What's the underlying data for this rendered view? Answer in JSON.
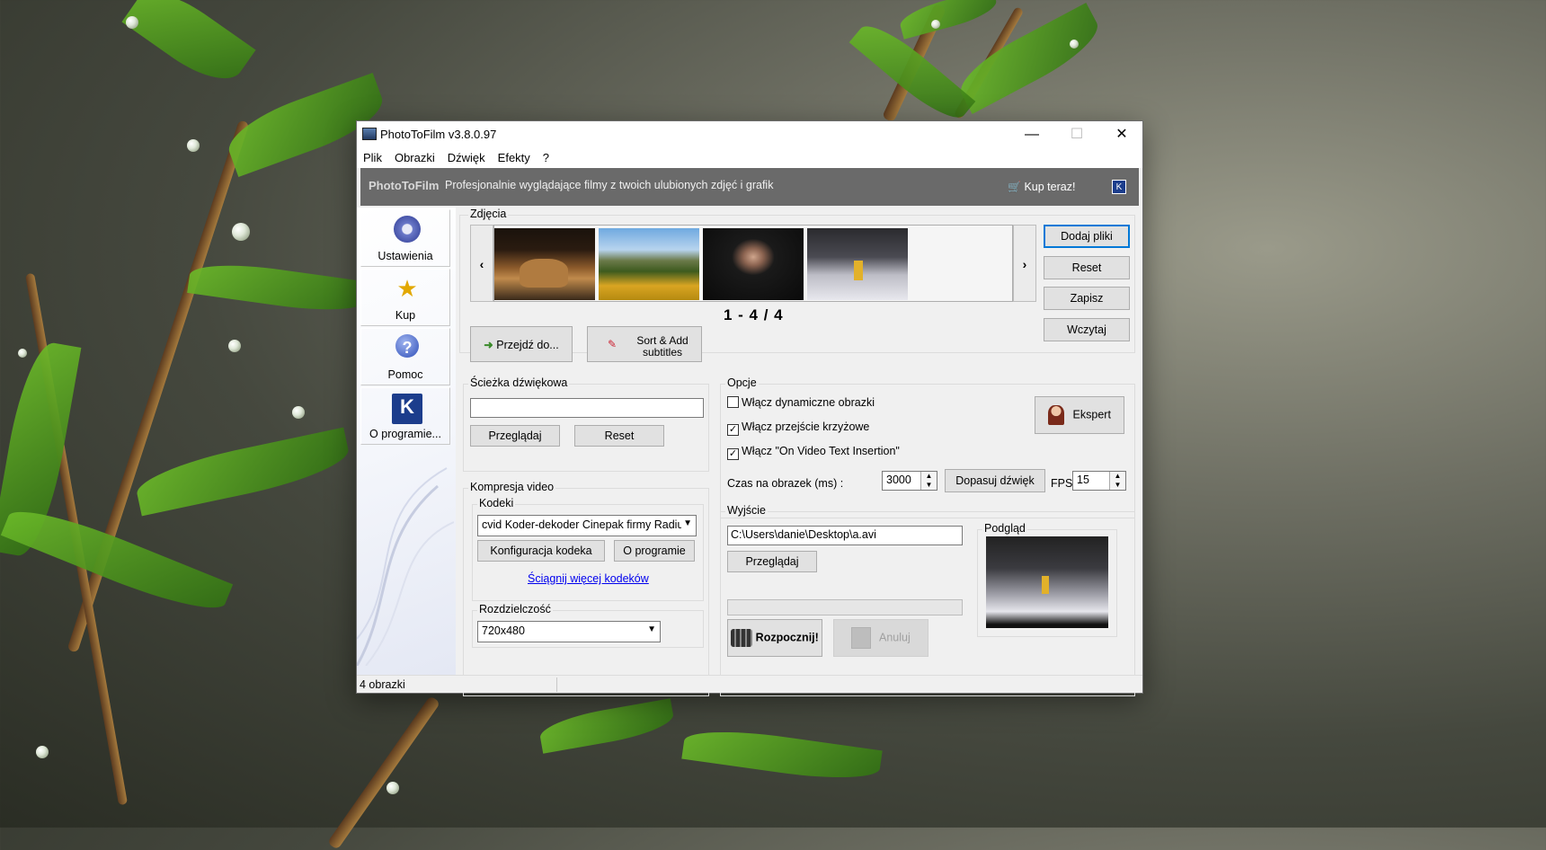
{
  "window": {
    "title": "PhotoToFilm v3.8.0.97",
    "minimize_glyph": "—",
    "maximize_glyph": "☐",
    "close_glyph": "✕"
  },
  "menu": [
    "Plik",
    "Obrazki",
    "Dźwięk",
    "Efekty",
    "?"
  ],
  "banner": {
    "brand": "PhotoToFilm",
    "tagline": "Profesjonalnie wyglądające filmy z twoich ulubionych zdjęć i grafik",
    "buy_label": "Kup teraz!",
    "cart_icon": "🛒"
  },
  "sidebar": {
    "items": [
      {
        "label": "Ustawienia",
        "icon": "gear-icon"
      },
      {
        "label": "Kup",
        "icon": "buy-star-icon"
      },
      {
        "label": "Pomoc",
        "icon": "help-icon"
      },
      {
        "label": "O programie...",
        "icon": "about-k-icon"
      }
    ]
  },
  "photos": {
    "group_label": "Zdjęcia",
    "prev_arrow": "‹",
    "next_arrow": "›",
    "thumbnails": [
      "dog",
      "mountain-meadow",
      "woman-portrait",
      "snowy-forest"
    ],
    "count": "1 - 4 / 4",
    "goto_label": "Przejdź do...",
    "sort_add_label": "Sort & Add subtitles",
    "add_files": "Dodaj pliki",
    "reset": "Reset",
    "save": "Zapisz",
    "load": "Wczytaj"
  },
  "audio": {
    "group_label": "Ścieżka dźwiękowa",
    "path_value": "",
    "browse": "Przeglądaj",
    "reset": "Reset"
  },
  "compression": {
    "group_label": "Kompresja video",
    "codecs_label": "Kodeki",
    "codec_selected": "cvid Koder-dekoder Cinepak firmy Radius",
    "configure": "Konfiguracja kodeka",
    "about": "O programie",
    "more_link": "Ściągnij więcej kodeków",
    "resolution_label": "Rozdzielczość",
    "resolution_selected": "720x480"
  },
  "options": {
    "group_label": "Opcje",
    "dynamic_images": {
      "label": "Włącz dynamiczne obrazki",
      "checked": false
    },
    "cross_transition": {
      "label": "Włącz przejście krzyżowe",
      "checked": true
    },
    "text_insertion": {
      "label": "Włącz \"On Video Text Insertion\"",
      "checked": true
    },
    "expert": "Ekspert",
    "time_label": "Czas na obrazek (ms) :",
    "time_value": "3000",
    "fit_audio": "Dopasuj dźwięk",
    "fps_label": "FPS",
    "fps_value": "15"
  },
  "output": {
    "group_label": "Wyjście",
    "path_value": "C:\\Users\\danie\\Desktop\\a.avi",
    "browse": "Przeglądaj",
    "preview_label": "Podgląd",
    "progress": 0,
    "start": "Rozpocznij!",
    "cancel": "Anuluj"
  },
  "status": {
    "text": "4 obrazki"
  }
}
